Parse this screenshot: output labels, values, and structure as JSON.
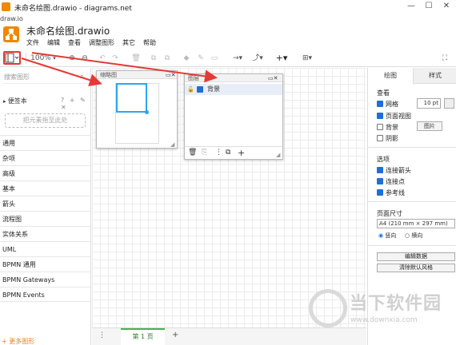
{
  "window": {
    "title": "未命名绘图.drawio - diagrams.net",
    "url": "draw.io",
    "minimize": "—",
    "maximize": "☐",
    "close": "✕"
  },
  "app": {
    "doc_title": "未命名绘图.drawio",
    "menu": [
      "文件",
      "编辑",
      "查看",
      "调整图形",
      "其它",
      "帮助"
    ]
  },
  "toolbar": {
    "zoom": "100%",
    "icons": [
      "format-panel-icon",
      "zoom-in-icon",
      "zoom-out-icon",
      "undo-icon",
      "redo-icon",
      "delete-icon",
      "to-front-icon",
      "to-back-icon",
      "fill-color-icon",
      "line-color-icon",
      "shadow-icon",
      "connection-icon",
      "waypoint-icon",
      "insert-icon",
      "table-icon",
      "fullscreen-icon"
    ]
  },
  "sidebar": {
    "search_placeholder": "搜索图形",
    "scratchpad": "便签本",
    "scratchpad_tools": "? + ✎ ✕",
    "dropzone": "把元素拖至此处",
    "libraries": [
      "通用",
      "杂项",
      "高级",
      "基本",
      "箭头",
      "流程图",
      "实体关系",
      "UML",
      "BPMN 通用",
      "BPMN Gateways",
      "BPMN Events"
    ],
    "more_shapes": "+ 更多图形"
  },
  "outline_window": {
    "title": "缩略图"
  },
  "layers_window": {
    "title": "图层",
    "layer_name": "背景"
  },
  "pages": {
    "current": "第 1 页"
  },
  "format_panel": {
    "tabs": [
      "绘图",
      "样式"
    ],
    "view_title": "查看",
    "grid_label": "网格",
    "grid_size": "10 pt",
    "page_view_label": "页面视图",
    "background_label": "背景",
    "background_image_button": "图片",
    "shadow_label": "阴影",
    "options_title": "选项",
    "connection_arrows_label": "连接箭头",
    "connection_points_label": "连接点",
    "guides_label": "参考线",
    "paper_size_title": "页面尺寸",
    "paper_size_value": "A4 (210 mm × 297 mm)",
    "portrait_label": "竖向",
    "landscape_label": "横向",
    "edit_data_button": "编辑数据",
    "clear_style_button": "清除默认风格"
  },
  "watermark": {
    "text": "当下软件园",
    "url": "www.downxia.com"
  },
  "colors": {
    "accent": "#f08705",
    "arrow": "#e53935",
    "selection": "#29a5f5",
    "checkbox": "#1e6fd9"
  }
}
